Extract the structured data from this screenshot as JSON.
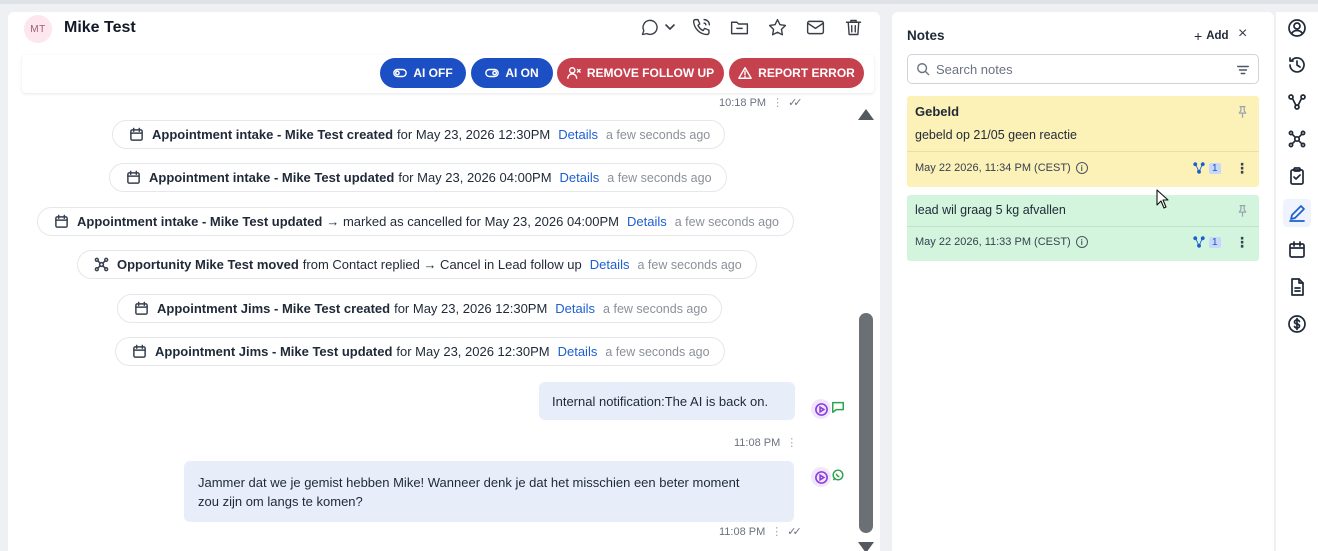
{
  "contact": {
    "initials": "MT",
    "name": "Mike Test"
  },
  "actions": {
    "ai_off": "AI OFF",
    "ai_on": "AI ON",
    "remove_follow_up": "REMOVE FOLLOW UP",
    "report_error": "REPORT ERROR"
  },
  "chat": {
    "top_time": "10:18 PM",
    "events": [
      {
        "bold": "Appointment intake - Mike Test created",
        "text": "for May 23, 2026 12:30PM",
        "link": "Details",
        "ago": "a few seconds ago",
        "icon": "calendar-icon"
      },
      {
        "bold": "Appointment intake - Mike Test updated",
        "text": "for May 23, 2026 04:00PM",
        "link": "Details",
        "ago": "a few seconds ago",
        "icon": "calendar-icon"
      },
      {
        "bold": "Appointment intake - Mike Test updated",
        "text": "→ marked as cancelled for May 23, 2026 04:00PM",
        "link": "Details",
        "ago": "a few seconds ago",
        "icon": "calendar-icon"
      },
      {
        "bold": "Opportunity Mike Test moved",
        "text": "from Contact replied → Cancel in Lead follow up",
        "link": "Details",
        "ago": "a few seconds ago",
        "icon": "opportunity-icon"
      },
      {
        "bold": "Appointment Jims - Mike Test created",
        "text": "for May 23, 2026 12:30PM",
        "link": "Details",
        "ago": "a few seconds ago",
        "icon": "calendar-icon"
      },
      {
        "bold": "Appointment Jims - Mike Test updated",
        "text": "for May 23, 2026 12:30PM",
        "link": "Details",
        "ago": "a few seconds ago",
        "icon": "calendar-icon"
      }
    ],
    "messages": [
      {
        "text": "Internal notification:The AI is back on.",
        "time": "11:08 PM"
      },
      {
        "line1": "Jammer dat we je gemist hebben Mike! Wanneer denk je dat het misschien een beter moment",
        "line2": "zou zijn om langs te komen?",
        "time": "11:08 PM"
      }
    ]
  },
  "notes": {
    "title": "Notes",
    "add_label": "Add",
    "close_label": "×",
    "search_placeholder": "Search notes",
    "items": [
      {
        "title": "Gebeld",
        "body": "gebeld op 21/05 geen reactie",
        "date": "May 22 2026, 11:34 PM (CEST)",
        "count": "1",
        "color": "#fcf1b7"
      },
      {
        "title": "",
        "body": "lead wil graag 5 kg afvallen",
        "date": "May 22 2026, 11:33 PM (CEST)",
        "count": "1",
        "color": "#d3f5dd"
      }
    ]
  },
  "colors": {
    "primary_blue": "#1d4fc4",
    "danger_red": "#c6414e",
    "link_blue": "#1d5fd1"
  }
}
